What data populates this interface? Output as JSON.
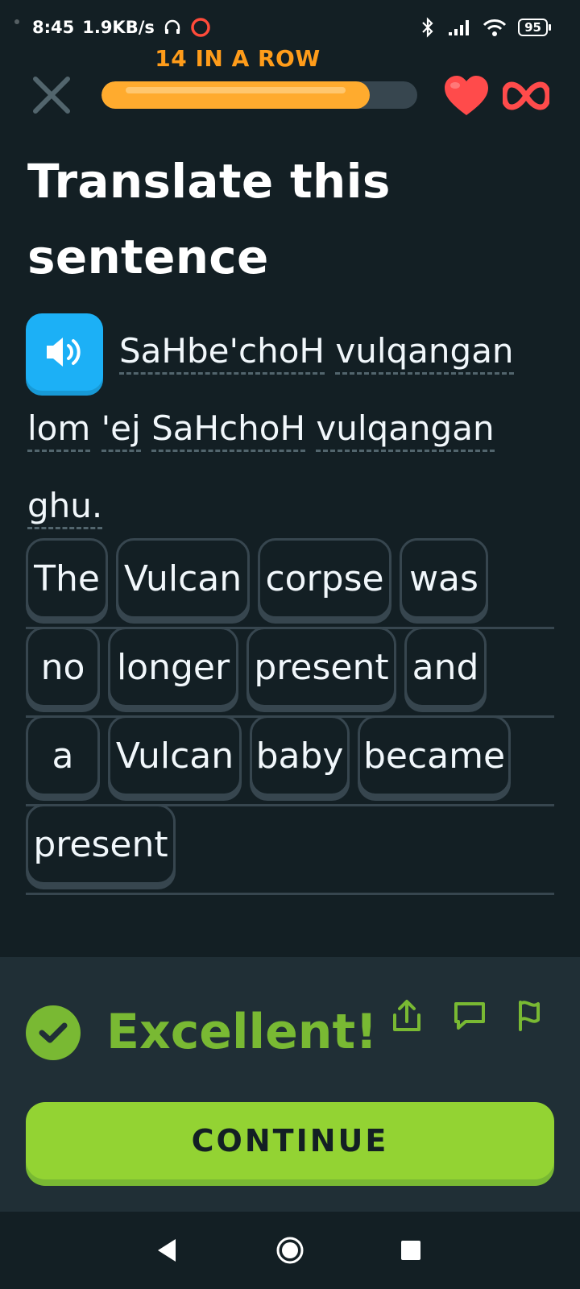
{
  "status_bar": {
    "time": "8:45",
    "speed": "1.9KB/s",
    "battery": "95"
  },
  "header": {
    "streak": "14 IN A ROW",
    "progress_fraction": 0.85,
    "hearts": "∞"
  },
  "prompt": {
    "title": "Translate this sentence",
    "sentence_words": [
      "SaHbe'choH",
      "vulqangan",
      "lom",
      "'ej",
      "SaHchoH",
      "vulqangan",
      "ghu."
    ]
  },
  "answer_tiles": [
    "The",
    "Vulcan",
    "corpse",
    "was",
    "no",
    "longer",
    "present",
    "and",
    "a",
    "Vulcan",
    "baby",
    "became",
    "present"
  ],
  "feedback": {
    "title": "Excellent!",
    "button_label": "CONTINUE"
  },
  "colors": {
    "background": "#131f24",
    "correct_green": "#79b933",
    "continue_green": "#93d333",
    "streak_orange": "#ffab2e",
    "speaker_blue": "#1cb0f6",
    "heart_red": "#ff4b4b"
  },
  "icons": {
    "close": "close-icon",
    "heart": "heart-icon",
    "infinity": "infinity-icon",
    "speaker": "speaker-icon",
    "check": "check-icon",
    "share": "share-icon",
    "comment": "comment-icon",
    "flag": "flag-icon"
  }
}
